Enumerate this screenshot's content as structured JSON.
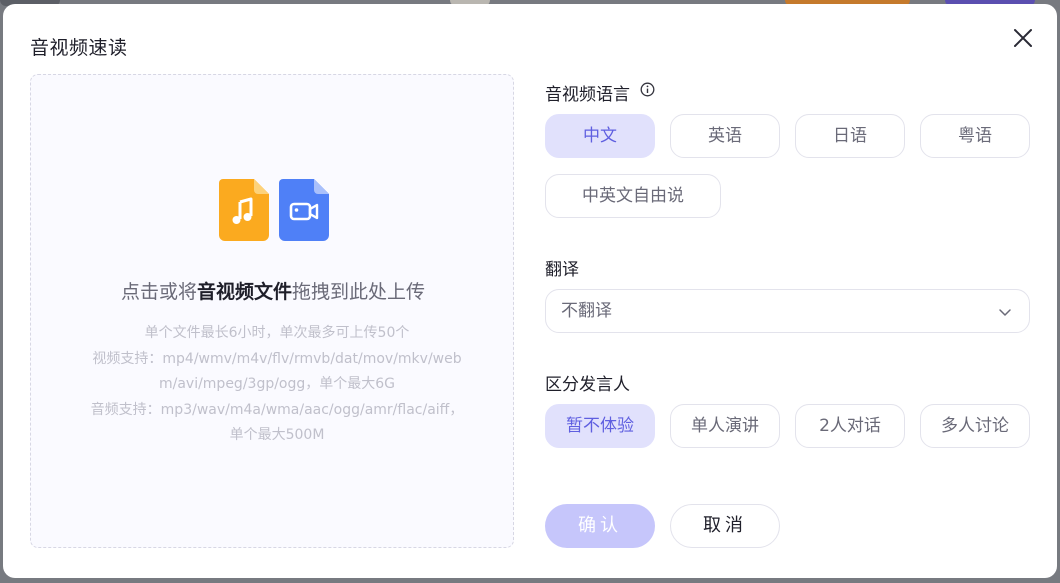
{
  "dialog": {
    "title": "音视频速读"
  },
  "upload": {
    "prompt_prefix": "点击或将",
    "prompt_bold": "音视频文件",
    "prompt_suffix": "拖拽到此处上传",
    "hints": [
      "单个文件最长6小时，单次最多可上传50个",
      "视频支持：mp4/wmv/m4v/flv/rmvb/dat/mov/mkv/webm/avi/mpeg/3gp/ogg，单个最大6G",
      "音频支持：mp3/wav/m4a/wma/aac/ogg/amr/flac/aiff，单个最大500M"
    ],
    "icons": [
      "music-file-icon",
      "video-file-icon"
    ],
    "icon_colors": {
      "audio": "#fbaa1f",
      "video": "#4f80f7"
    }
  },
  "language": {
    "label": "音视频语言",
    "options": [
      "中文",
      "英语",
      "日语",
      "粤语",
      "中英文自由说"
    ],
    "selected": "中文"
  },
  "translate": {
    "label": "翻译",
    "value": "不翻译"
  },
  "speaker": {
    "label": "区分发言人",
    "options": [
      "暂不体验",
      "单人演讲",
      "2人对话",
      "多人讨论"
    ],
    "selected": "暂不体验"
  },
  "actions": {
    "confirm": "确认",
    "cancel": "取消"
  },
  "colors": {
    "accent": "#5f5fe0",
    "accent_bg": "#e1e1fc",
    "confirm_bg": "#c6c6fb"
  }
}
